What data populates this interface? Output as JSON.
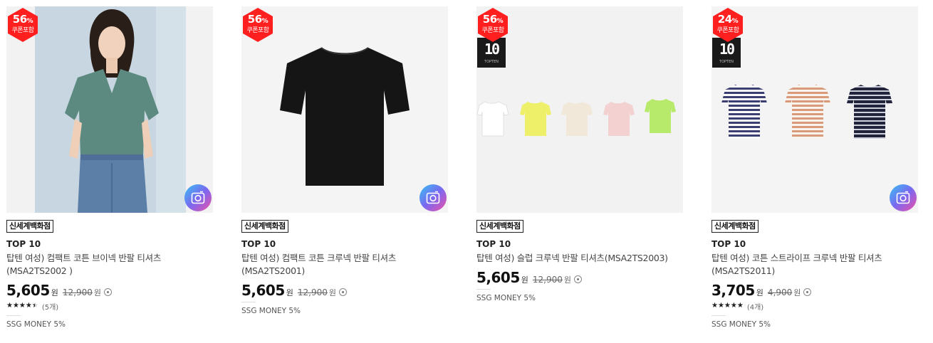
{
  "products": [
    {
      "discount": "56",
      "discount_unit": "%",
      "coupon": "쿠폰포함",
      "store": "신세계백화점",
      "brand": "TOP 10",
      "title": "탑텐 여성) 컴팩트 코튼 브이넥 반팔 티셔츠 (MSA2TS2002 )",
      "price": "5,605",
      "price_unit": "원",
      "original_price": "12,900",
      "original_unit": "원",
      "rating": 4.5,
      "review_count": "(5개)",
      "ssg_money": "SSG MONEY 5%"
    },
    {
      "discount": "56",
      "discount_unit": "%",
      "coupon": "쿠폰포함",
      "store": "신세계백화점",
      "brand": "TOP 10",
      "title": "탑텐 여성) 컴팩트 코튼 크루넥 반팔 티셔츠(MSA2TS2001)",
      "price": "5,605",
      "price_unit": "원",
      "original_price": "12,900",
      "original_unit": "원",
      "ssg_money": "SSG MONEY 5%"
    },
    {
      "discount": "56",
      "discount_unit": "%",
      "coupon": "쿠폰포함",
      "top10_logo": "10",
      "top10_small": "TOPTEN",
      "store": "신세계백화점",
      "brand": "TOP 10",
      "title": "탑텐 여성) 슬럽 크루넥 반팔 티셔츠(MSA2TS2003)",
      "price": "5,605",
      "price_unit": "원",
      "original_price": "12,900",
      "original_unit": "원",
      "ssg_money": "SSG MONEY 5%"
    },
    {
      "discount": "24",
      "discount_unit": "%",
      "coupon": "쿠폰포함",
      "top10_logo": "10",
      "top10_small": "TOPTEN",
      "store": "신세계백화점",
      "brand": "TOP 10",
      "title": "탑텐 여성) 코튼 스트라이프 크루넥 반팔 티셔츠 (MSA2TS2011)",
      "price": "3,705",
      "price_unit": "원",
      "original_price": "4,900",
      "original_unit": "원",
      "rating": 5,
      "review_count": "(4개)",
      "ssg_money": "SSG MONEY 5%"
    }
  ],
  "icons": {
    "camera": "camera-search-icon",
    "info": "info-circle-icon",
    "star": "star-icon"
  },
  "colors": {
    "badge_red": "#ff1f1f",
    "camera_gradient": [
      "#36c2f2",
      "#7a68f0",
      "#f050a8"
    ]
  }
}
